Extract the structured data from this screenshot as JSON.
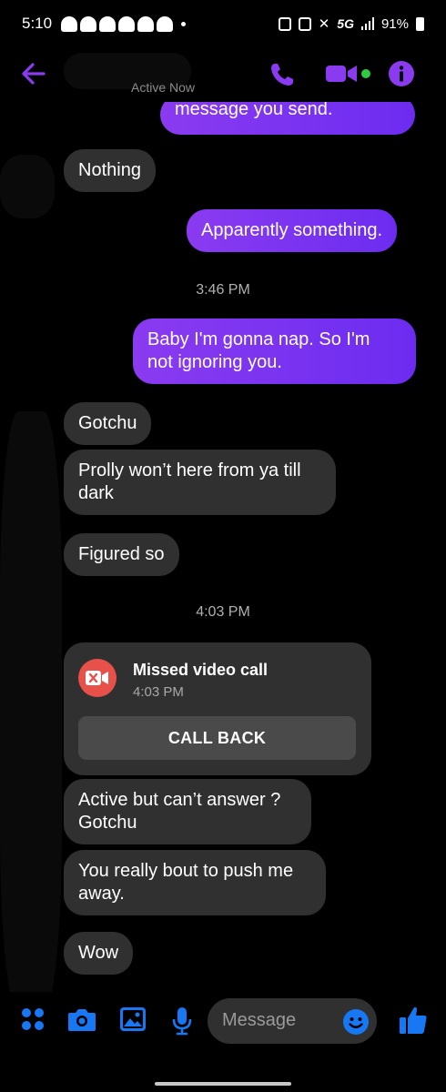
{
  "status_bar": {
    "time": "5:10",
    "network": "5G",
    "battery": "91%"
  },
  "header": {
    "status_text": "Active Now"
  },
  "messages": {
    "m0": "message you send.",
    "m1": "Nothing",
    "m2": "Apparently something.",
    "ts1": "3:46 PM",
    "m3_line1": "Baby I'm gonna nap. So I'm",
    "m3_line2": "not ignoring you.",
    "m4": "Gotchu",
    "m5_line1": "Prolly won’t here from ya till",
    "m5_line2": "dark",
    "m6": "Figured so",
    "ts2": "4:03 PM",
    "m7_line1": "Active but can’t answer ?",
    "m7_line2": "Gotchu",
    "m8_line1": "You really bout to push me",
    "m8_line2": "away.",
    "m9": "Wow"
  },
  "call_card": {
    "title": "Missed video call",
    "time": "4:03 PM",
    "button_label": "CALL BACK"
  },
  "composer": {
    "placeholder": "Message"
  },
  "colors": {
    "accent": "#7b3ff2",
    "outgoing_bubble": "#7b3ff2",
    "incoming_bubble": "#303030",
    "missed_call": "#e8504a",
    "composer_icons": "#1877f2",
    "online": "#2ecc40"
  },
  "icons": {
    "back": "back-arrow-icon",
    "phone": "phone-icon",
    "video": "video-camera-icon",
    "info": "info-icon",
    "missed_call": "missed-video-call-icon",
    "menu": "menu-dots-icon",
    "camera": "camera-icon",
    "gallery": "gallery-icon",
    "mic": "microphone-icon",
    "emoji": "emoji-icon",
    "like": "thumbs-up-icon"
  }
}
